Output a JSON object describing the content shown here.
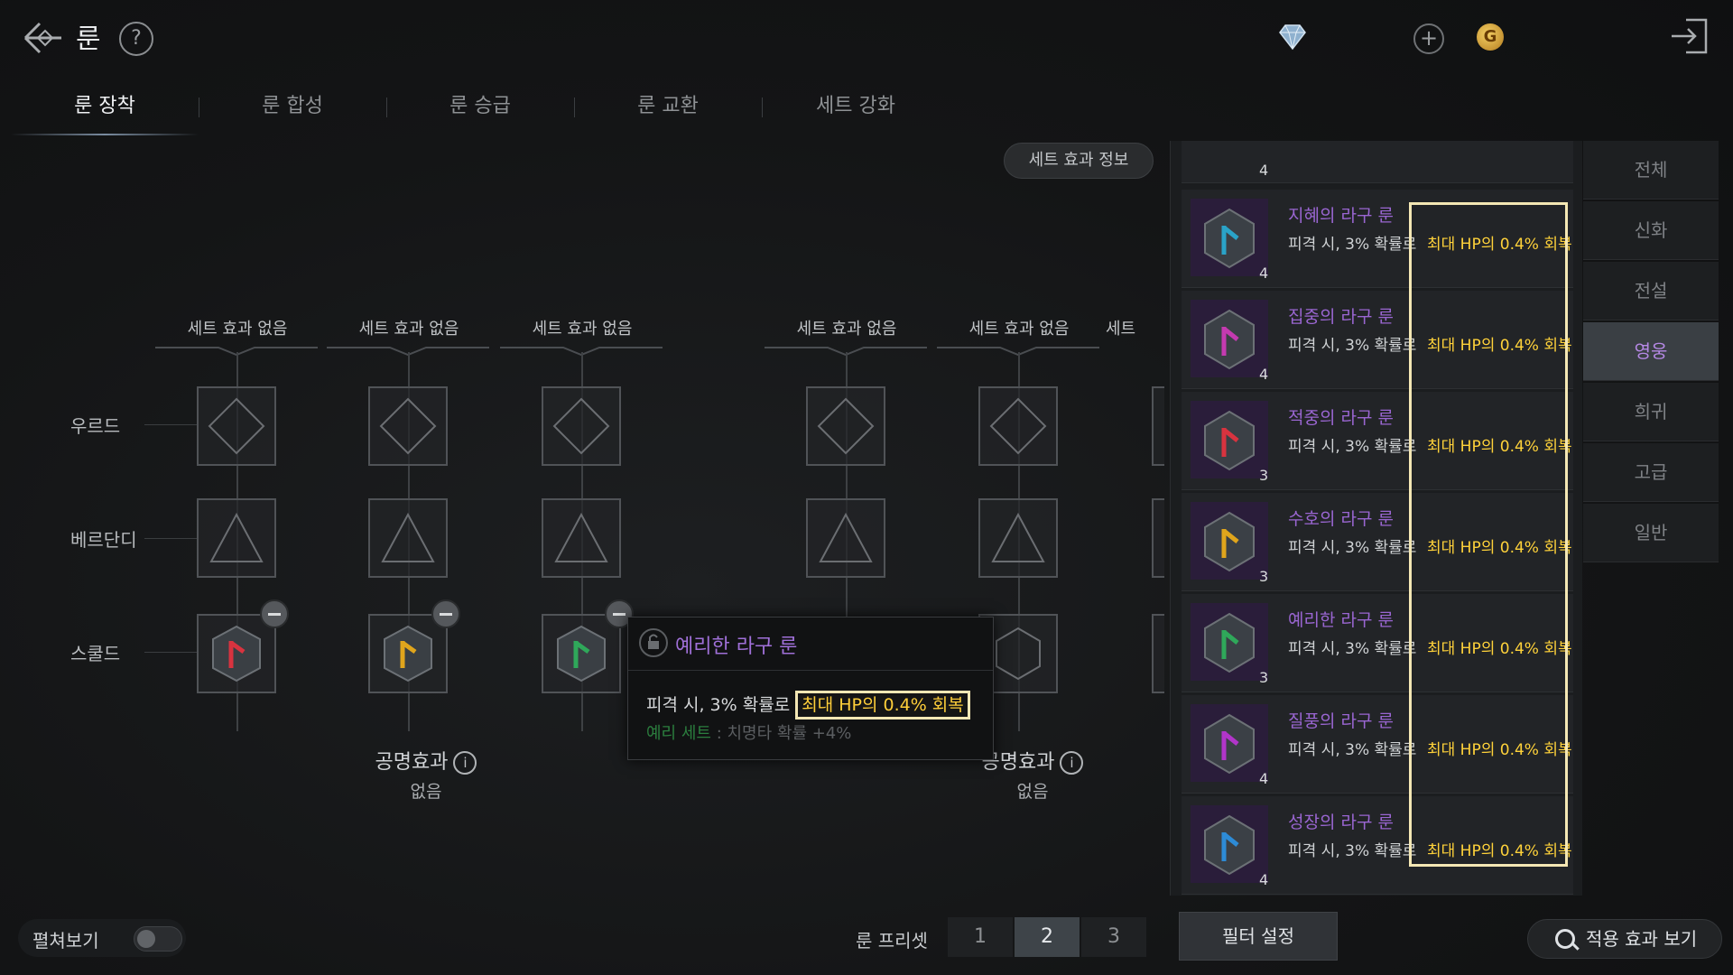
{
  "header": {
    "title": "룬",
    "help": "?",
    "gold_symbol": "G"
  },
  "tabs": [
    "룬 장착",
    "룬 합성",
    "룬 승급",
    "룬 교환",
    "세트 강화"
  ],
  "set_info_button": "세트 효과 정보",
  "rows": [
    "우르드",
    "베르단디",
    "스쿨드"
  ],
  "columns": [
    {
      "set_label": "세트 효과 없음"
    },
    {
      "set_label": "세트 효과 없음"
    },
    {
      "set_label": "세트 효과 없음"
    },
    {
      "set_label": "세트 효과 없음"
    },
    {
      "set_label": "세트 효과 없음"
    },
    {
      "set_label": "세트"
    }
  ],
  "resonance": [
    {
      "title": "공명효과",
      "value": "없음"
    },
    {
      "title": "공명효과",
      "value": "없음"
    }
  ],
  "info_symbol": "i",
  "tooltip": {
    "name": "예리한 라구 룬",
    "desc_prefix": "피격 시, 3% 확률로",
    "desc_highlight": "최대 HP의 0.4% 회복",
    "set_name": "예리 세트",
    "set_effect": " : 치명타 확률 +4%"
  },
  "rune_list": [
    {
      "name": "지혜의 라구 룬",
      "count": "4",
      "desc": "피격 시, 3% 확률로",
      "effect": "최대 HP의 0.4% 회복",
      "color": "#2aa3c8"
    },
    {
      "name": "집중의 라구 룬",
      "count": "4",
      "desc": "피격 시, 3% 확률로",
      "effect": "최대 HP의 0.4% 회복",
      "color": "#c43ab0"
    },
    {
      "name": "적중의 라구 룬",
      "count": "3",
      "desc": "피격 시, 3% 확률로",
      "effect": "최대 HP의 0.4% 회복",
      "color": "#d8333f"
    },
    {
      "name": "수호의 라구 룬",
      "count": "3",
      "desc": "피격 시, 3% 확률로",
      "effect": "최대 HP의 0.4% 회복",
      "color": "#e0a51c"
    },
    {
      "name": "예리한 라구 룬",
      "count": "3",
      "desc": "피격 시, 3% 확률로",
      "effect": "최대 HP의 0.4% 회복",
      "color": "#2fa85a"
    },
    {
      "name": "질풍의 라구 룬",
      "count": "4",
      "desc": "피격 시, 3% 확률로",
      "effect": "최대 HP의 0.4% 회복",
      "color": "#b135c9"
    },
    {
      "name": "성장의 라구 룬",
      "count": "4",
      "desc": "피격 시, 3% 확률로",
      "effect": "최대 HP의 0.4% 회복",
      "color": "#2d8bd6"
    }
  ],
  "partial_top_item": {
    "count": "4"
  },
  "grades": [
    "전체",
    "신화",
    "전설",
    "영웅",
    "희귀",
    "고급",
    "일반"
  ],
  "active_grade_index": 3,
  "bottom": {
    "unfold_label": "펼쳐보기",
    "preset_label": "룬 프리셋",
    "presets": [
      "1",
      "2",
      "3"
    ],
    "active_preset_index": 1,
    "filter_button": "필터 설정",
    "apply_button": "적용 효과 보기"
  },
  "colors": {
    "accent_purple": "#9a66d2",
    "effect_yellow": "#ffd23a",
    "highlight_border": "#f4e7b4"
  }
}
